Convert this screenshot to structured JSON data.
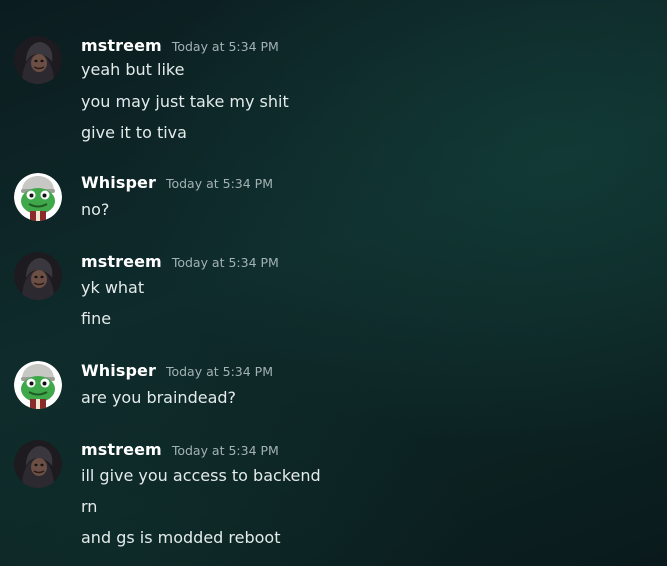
{
  "messages": [
    {
      "author": "mstreem",
      "timestamp": "Today at 5:34 PM",
      "avatar_icon": "hooded-figure-avatar",
      "lines": [
        "yeah but like",
        "you may just take my shit",
        "give it to tiva"
      ]
    },
    {
      "author": "Whisper",
      "timestamp": "Today at 5:34 PM",
      "avatar_icon": "green-frog-avatar",
      "lines": [
        "no?"
      ]
    },
    {
      "author": "mstreem",
      "timestamp": "Today at 5:34 PM",
      "avatar_icon": "hooded-figure-avatar",
      "lines": [
        "yk what",
        "fine"
      ]
    },
    {
      "author": "Whisper",
      "timestamp": "Today at 5:34 PM",
      "avatar_icon": "green-frog-avatar",
      "lines": [
        "are you braindead?"
      ]
    },
    {
      "author": "mstreem",
      "timestamp": "Today at 5:34 PM",
      "avatar_icon": "hooded-figure-avatar",
      "lines": [
        "ill give you access to backend",
        "rn",
        "and gs is modded reboot"
      ]
    }
  ],
  "colors": {
    "username": "#ffffff",
    "timestamp": "#a3b2b3",
    "message_text": "#e3ebeb",
    "frog_green": "#3fa84a"
  }
}
